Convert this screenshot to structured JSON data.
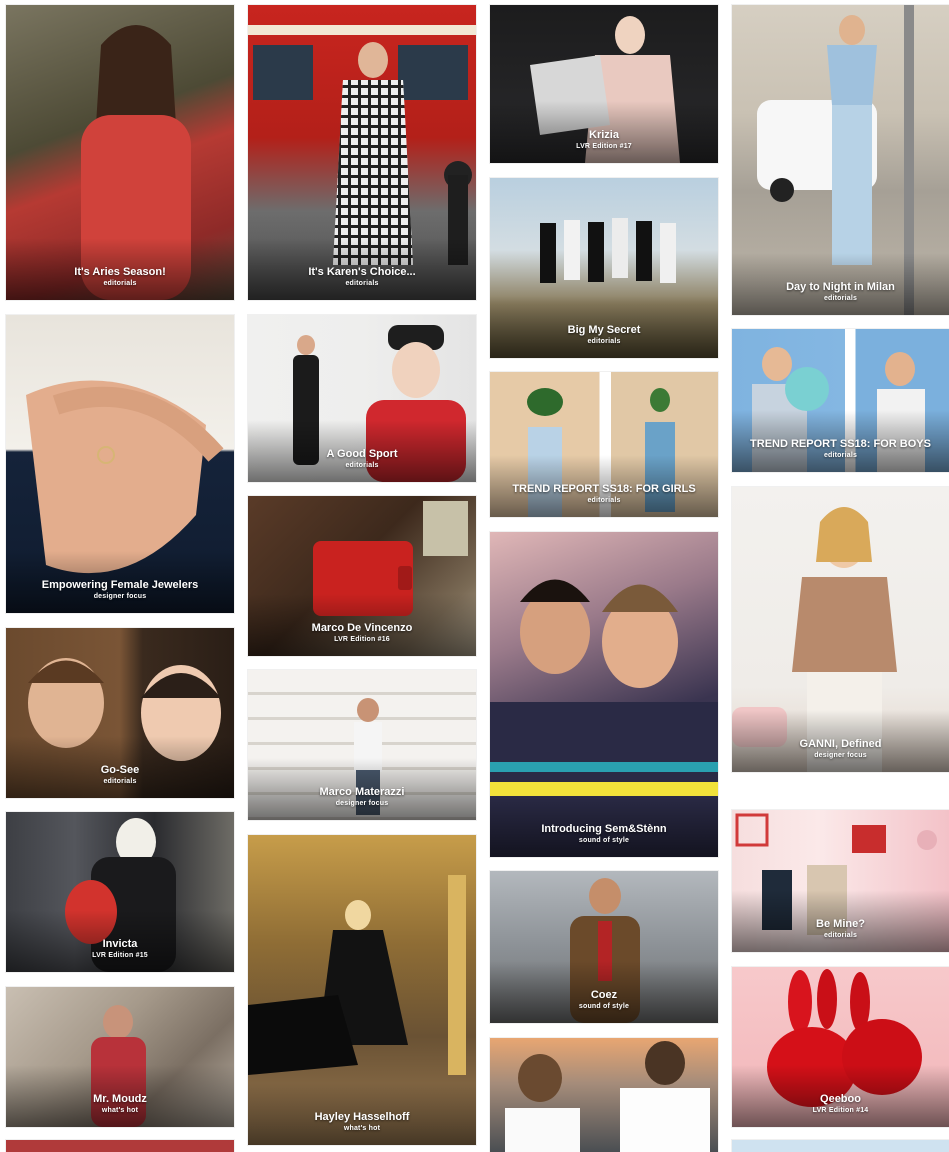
{
  "cards": [
    {
      "title": "It's Aries Season!",
      "category": "editorials"
    },
    {
      "title": "Empowering Female Jewelers",
      "category": "designer focus"
    },
    {
      "title": "Go-See",
      "category": "editorials"
    },
    {
      "title": "Invicta",
      "category": "LVR Edition #15"
    },
    {
      "title": "Mr. Moudz",
      "category": "what's hot"
    },
    {
      "title": "It's Karen's Choice...",
      "category": "editorials"
    },
    {
      "title": "A Good Sport",
      "category": "editorials"
    },
    {
      "title": "Marco De Vincenzo",
      "category": "LVR Edition #16"
    },
    {
      "title": "Marco Materazzi",
      "category": "designer focus"
    },
    {
      "title": "Hayley Hasselhoff",
      "category": "what's hot"
    },
    {
      "title": "Krizia",
      "category": "LVR Edition #17"
    },
    {
      "title": "Big My Secret",
      "category": "editorials"
    },
    {
      "title": "TREND REPORT SS18: FOR GIRLS",
      "category": "editorials"
    },
    {
      "title": "Introducing Sem&Stènn",
      "category": "sound of style"
    },
    {
      "title": "Coez",
      "category": "sound of style"
    },
    {
      "title": "Day to Night in Milan",
      "category": "editorials"
    },
    {
      "title": "TREND REPORT SS18: FOR BOYS",
      "category": "editorials"
    },
    {
      "title": "GANNI, Defined",
      "category": "designer focus"
    },
    {
      "title": "Be Mine?",
      "category": "editorials"
    },
    {
      "title": "Qeeboo",
      "category": "LVR Edition #14"
    }
  ]
}
